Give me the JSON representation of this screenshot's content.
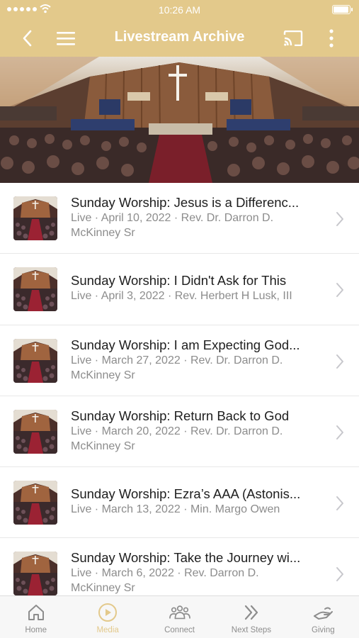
{
  "status_bar": {
    "time": "10:26 AM",
    "battery_level": 1.0
  },
  "nav": {
    "title": "Livestream Archive"
  },
  "items": [
    {
      "title": "Sunday Worship: Jesus is a Differenc...",
      "sub1": "Live · April 10, 2022 · Rev. Dr. Darron D.",
      "sub2": "McKinney Sr"
    },
    {
      "title": "Sunday Worship: I Didn't Ask for This",
      "sub1": "Live · April 3, 2022 · Rev. Herbert H Lusk, III",
      "sub2": ""
    },
    {
      "title": "Sunday Worship: I am Expecting God...",
      "sub1": "Live · March 27, 2022 · Rev. Dr. Darron D.",
      "sub2": "McKinney Sr"
    },
    {
      "title": "Sunday Worship: Return Back to God",
      "sub1": "Live · March 20, 2022 · Rev. Dr. Darron D.",
      "sub2": "McKinney Sr"
    },
    {
      "title": "Sunday Worship: Ezra’s AAA (Astonis...",
      "sub1": "Live · March 13, 2022 · Min. Margo Owen",
      "sub2": ""
    },
    {
      "title": "Sunday Worship: Take the Journey wi...",
      "sub1": "Live · March 6, 2022 · Rev. Darron D.",
      "sub2": "McKinney Sr"
    }
  ],
  "tabs": [
    {
      "label": "Home",
      "icon": "home-icon",
      "active": false
    },
    {
      "label": "Media",
      "icon": "play-circle-icon",
      "active": true
    },
    {
      "label": "Connect",
      "icon": "people-group-icon",
      "active": false
    },
    {
      "label": "Next Steps",
      "icon": "double-chevron-icon",
      "active": false
    },
    {
      "label": "Giving",
      "icon": "giving-hand-icon",
      "active": false
    }
  ],
  "colors": {
    "accent": "#e3c98b",
    "tab_inactive": "#8d8d8d",
    "subtitle": "#8c8c8c"
  }
}
